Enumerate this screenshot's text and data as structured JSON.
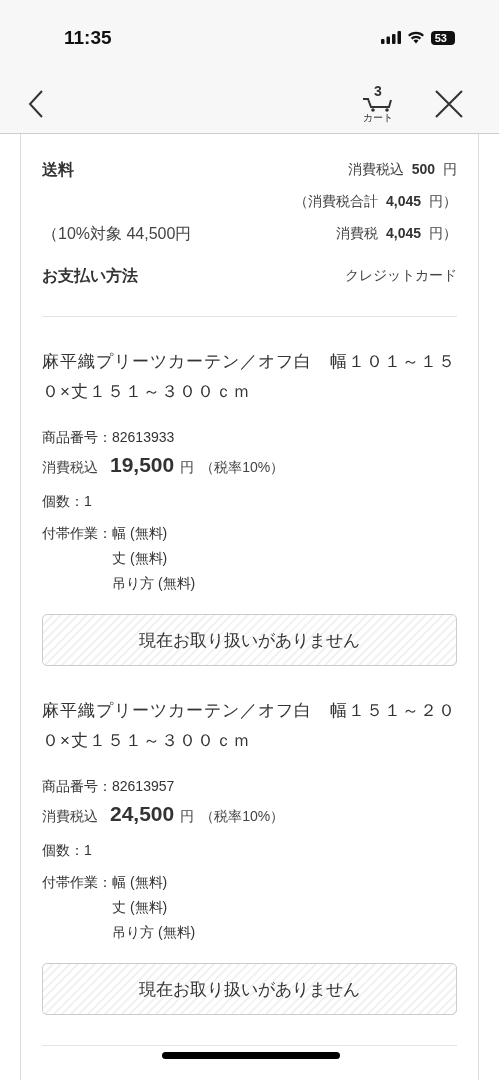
{
  "status_bar": {
    "time": "11:35",
    "battery": "53"
  },
  "nav": {
    "cart_count": "3",
    "cart_label": "カート"
  },
  "summary": {
    "shipping": {
      "label": "送料",
      "tax_label": "消費税込",
      "amount": "500",
      "unit": "円"
    },
    "tax_total": {
      "label": "（消費税合計",
      "amount": "4,045",
      "unit": "円）"
    },
    "tax_breakdown": {
      "target": "（10%対象 44,500円",
      "label": "消費税",
      "amount": "4,045",
      "unit": "円）"
    },
    "payment": {
      "label": "お支払い方法",
      "value": "クレジットカード"
    }
  },
  "items": [
    {
      "title": "麻平織プリーツカーテン／オフ白　幅１０１～１５０×丈１５１～３００ｃｍ",
      "product_no": "商品番号：82613933",
      "price_label": "消費税込",
      "price": "19,500",
      "unit": "円",
      "tax_rate": "（税率10%）",
      "quantity": "個数：1",
      "options_label": "付帯作業：",
      "options": [
        "幅 (無料)",
        "丈 (無料)",
        "吊り方 (無料)"
      ],
      "button": {
        "label": "現在お取り扱いがありません",
        "disabled": true
      }
    },
    {
      "title": "麻平織プリーツカーテン／オフ白　幅１５１～２００×丈１５１～３００ｃｍ",
      "product_no": "商品番号：82613957",
      "price_label": "消費税込",
      "price": "24,500",
      "unit": "円",
      "tax_rate": "（税率10%）",
      "quantity": "個数：1",
      "options_label": "付帯作業：",
      "options": [
        "幅 (無料)",
        "丈 (無料)",
        "吊り方 (無料)"
      ],
      "button": {
        "label": "現在お取り扱いがありません",
        "disabled": true
      }
    }
  ]
}
